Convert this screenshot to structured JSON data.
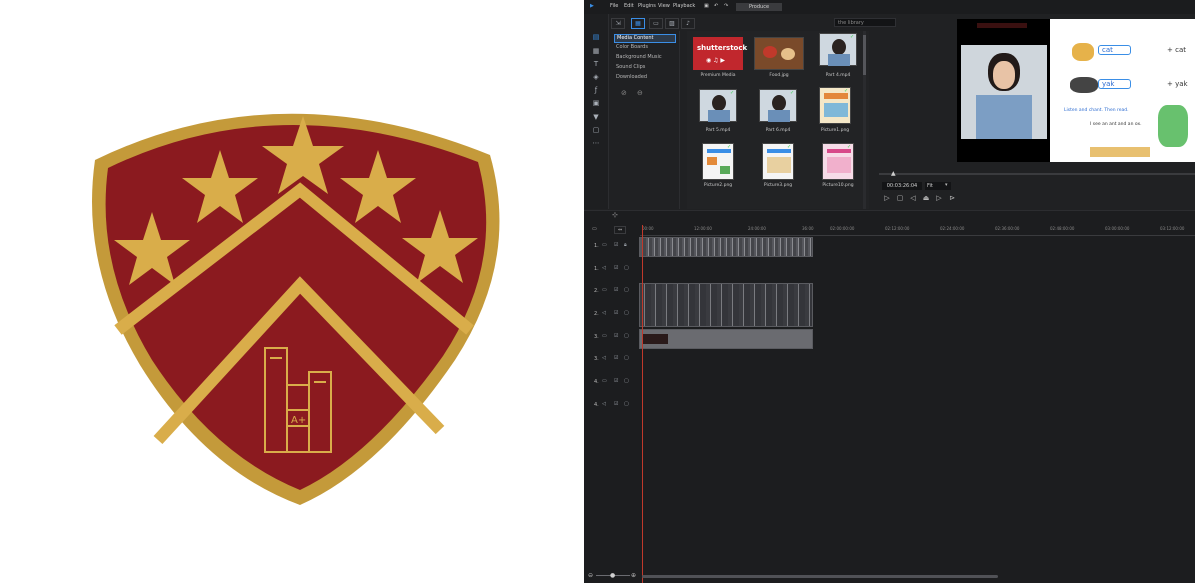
{
  "crest": {
    "colors": {
      "field": "#8b1a1f",
      "border": "#c49a3a",
      "gold": "#d9ad4a"
    },
    "badge_text": "A+"
  },
  "editor": {
    "menu": [
      "File",
      "Edit",
      "Plugins",
      "View",
      "Playback"
    ],
    "produce_label": "Produce",
    "search_placeholder": "the library",
    "categories": [
      "Media Content",
      "Color Boards",
      "Background Music",
      "Sound Clips",
      "Downloaded"
    ],
    "media": [
      {
        "label": "Premium Media",
        "kind": "shutterstock",
        "text": "shutterstock"
      },
      {
        "label": "Food.jpg",
        "kind": "food"
      },
      {
        "label": "Part 4.mp4",
        "kind": "person"
      },
      {
        "label": "Part 5.mp4",
        "kind": "person"
      },
      {
        "label": "Part 6.mp4",
        "kind": "person"
      },
      {
        "label": "Picture1.png",
        "kind": "worksheet"
      },
      {
        "label": "Picture2.png",
        "kind": "worksheet"
      },
      {
        "label": "Picture3.png",
        "kind": "worksheet"
      },
      {
        "label": "Picture10.png",
        "kind": "worksheet"
      }
    ],
    "preview": {
      "words": [
        "cat",
        "yak"
      ],
      "word_suffix": [
        "+ cat",
        "+ yak"
      ],
      "instruction": "Listen and chant. Then read.",
      "sentence": "I see an ant and an ox."
    },
    "timecode": "00:03:26:04",
    "fit_value": "Fit",
    "ruler_ticks": [
      "00:00",
      "12:00:00",
      "24:00:00",
      "36:00",
      "02:00:00:00",
      "02:12:00:00",
      "02:24:00:00",
      "02:36:00:00",
      "02:48:00:00",
      "03:00:00:00",
      "03:12:00:00"
    ],
    "tracks": [
      "1.",
      "1.",
      "2.",
      "2.",
      "3.",
      "3.",
      "4.",
      "4."
    ]
  }
}
